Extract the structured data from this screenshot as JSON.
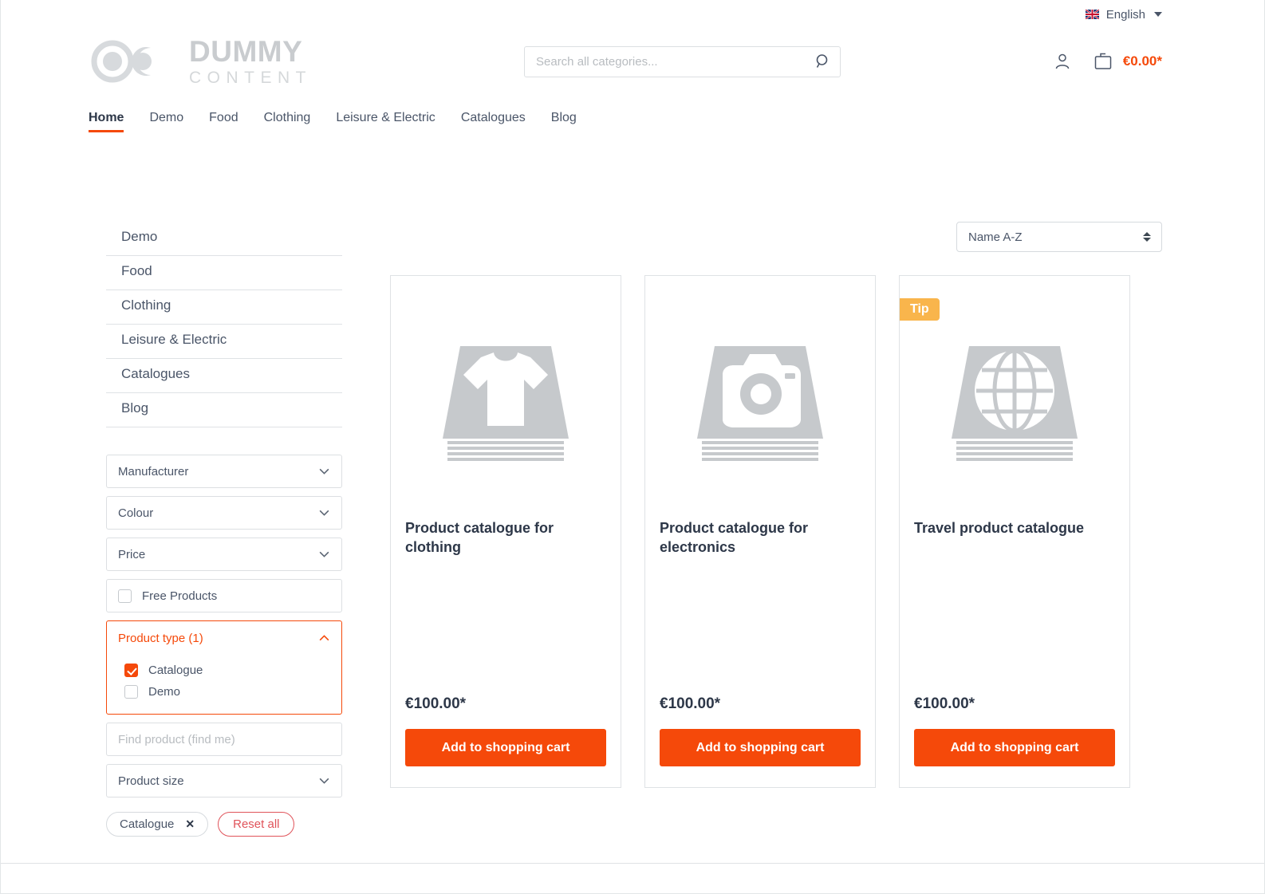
{
  "topbar": {
    "language": "English",
    "flag_icon": "uk-flag-icon"
  },
  "header": {
    "logo_line1": "DUMMY",
    "logo_line2": "CONTENT",
    "search_placeholder": "Search all categories...",
    "search_value": "",
    "cart_total": "€0.00*",
    "account_icon": "person-icon",
    "cart_icon": "shopping-bag-icon",
    "search_icon": "search-icon"
  },
  "nav": {
    "items": [
      {
        "label": "Home",
        "active": true
      },
      {
        "label": "Demo",
        "active": false
      },
      {
        "label": "Food",
        "active": false
      },
      {
        "label": "Clothing",
        "active": false
      },
      {
        "label": "Leisure & Electric",
        "active": false
      },
      {
        "label": "Catalogues",
        "active": false
      },
      {
        "label": "Blog",
        "active": false
      }
    ]
  },
  "sidebar": {
    "categories": [
      {
        "label": "Demo"
      },
      {
        "label": "Food"
      },
      {
        "label": "Clothing"
      },
      {
        "label": "Leisure & Electric"
      },
      {
        "label": "Catalogues"
      },
      {
        "label": "Blog"
      }
    ],
    "filters": {
      "manufacturer": "Manufacturer",
      "colour": "Colour",
      "price": "Price",
      "free_products": "Free Products",
      "free_products_checked": false,
      "product_type_label": "Product type (1)",
      "product_type_options": [
        {
          "label": "Catalogue",
          "checked": true
        },
        {
          "label": "Demo",
          "checked": false
        }
      ],
      "find_product_placeholder": "Find product (find me)",
      "find_product_value": "",
      "product_size": "Product size"
    },
    "active_filter_pill": "Catalogue",
    "active_filter_remove": "✕",
    "reset_all": "Reset all"
  },
  "results": {
    "sort_value": "Name A-Z",
    "products": [
      {
        "title": "Product catalogue for clothing",
        "price": "€100.00*",
        "cart_label": "Add to shopping cart",
        "badge": "",
        "image_icon": "tshirt-catalogue-icon"
      },
      {
        "title": "Product catalogue for electronics",
        "price": "€100.00*",
        "cart_label": "Add to shopping cart",
        "badge": "",
        "image_icon": "camera-catalogue-icon"
      },
      {
        "title": "Travel product catalogue",
        "price": "€100.00*",
        "cart_label": "Add to shopping cart",
        "badge": "Tip",
        "image_icon": "globe-catalogue-icon"
      }
    ]
  },
  "colors": {
    "accent": "#f5490a",
    "badge": "#f9b54c",
    "reset": "#e0535a",
    "placeholder_grey": "#c6c9cc"
  }
}
